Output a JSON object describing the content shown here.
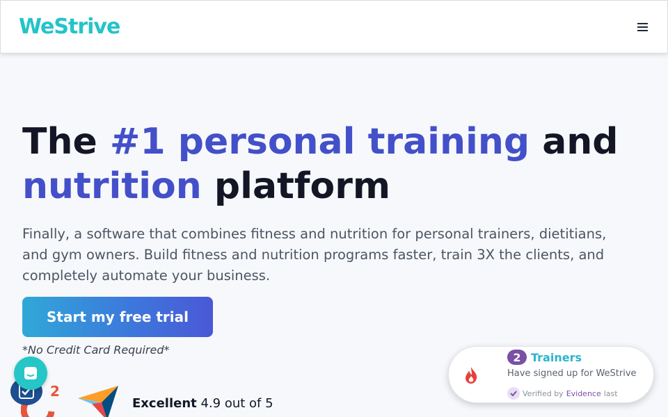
{
  "header": {
    "logo_text": "WeStrive",
    "menu_icon": "hamburger-menu-icon"
  },
  "hero": {
    "title_part1": "The ",
    "title_accent1": "#1 personal training",
    "title_part2": " and",
    "title_accent2": "nutrition",
    "title_part3": " platform",
    "subtitle": "Finally, a software that combines fitness and nutrition for personal trainers, dietitians, and gym owners. Build fitness and nutrition programs faster, train 3X the clients, and completely automate your business.",
    "cta_label": "Start my free trial",
    "no_card_note": "*No Credit Card Required*"
  },
  "rating": {
    "label": "Excellent",
    "score_text": "4.9 out of 5"
  },
  "social_proof": {
    "count": "2",
    "label": "Trainers",
    "message": "Have signed up for WeStrive",
    "verified_prefix": "Verified by",
    "verified_by": "Evidence",
    "verified_suffix": "last"
  },
  "colors": {
    "brand": "#23c4c9",
    "accent": "#4350c9",
    "proof_purple": "#7a4fa6"
  }
}
